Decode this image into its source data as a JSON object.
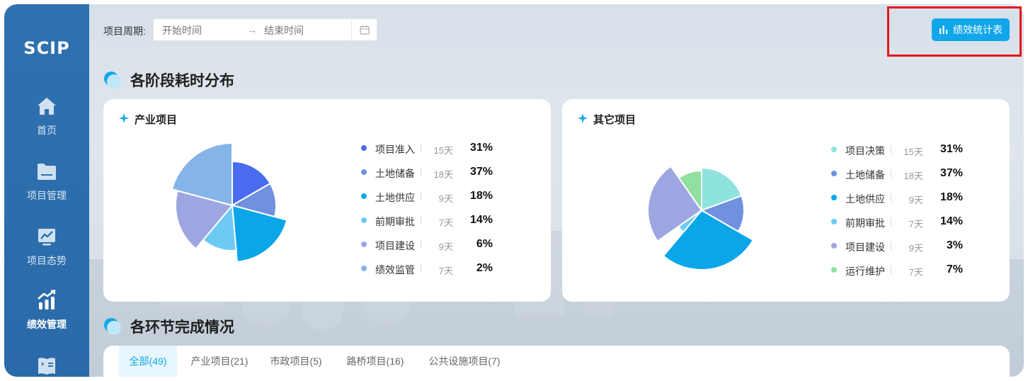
{
  "sidebar": {
    "logo": "SCIP",
    "items": [
      {
        "label": "首页",
        "icon": "home-icon",
        "active": false
      },
      {
        "label": "项目管理",
        "icon": "folder-icon",
        "active": false
      },
      {
        "label": "项目态势",
        "icon": "trend-chart-icon",
        "active": false
      },
      {
        "label": "绩效管理",
        "icon": "bar-chart-icon",
        "active": true
      },
      {
        "label": "",
        "icon": "book-icon",
        "active": false
      }
    ]
  },
  "toolbar": {
    "period_label": "项目周期:",
    "start_placeholder": "开始时间",
    "end_placeholder": "结束时间",
    "range_separator": "→",
    "stat_button_label": "绩效统计表"
  },
  "section1": {
    "title": "各阶段耗时分布"
  },
  "section2": {
    "title": "各环节完成情况"
  },
  "cards": [
    {
      "title": "产业项目",
      "items": [
        {
          "name": "项目准入",
          "days": "15天",
          "pct": "31%",
          "color": "#4a6cf0"
        },
        {
          "name": "土地储备",
          "days": "18天",
          "pct": "37%",
          "color": "#7090e0"
        },
        {
          "name": "土地供应",
          "days": "9天",
          "pct": "18%",
          "color": "#0aa6e8"
        },
        {
          "name": "前期审批",
          "days": "7天",
          "pct": "14%",
          "color": "#6ccaf5"
        },
        {
          "name": "项目建设",
          "days": "9天",
          "pct": "6%",
          "color": "#9ea6e2"
        },
        {
          "name": "绩效监管",
          "days": "7天",
          "pct": "2%",
          "color": "#85b4e8"
        }
      ]
    },
    {
      "title": "其它项目",
      "items": [
        {
          "name": "项目决策",
          "days": "15天",
          "pct": "31%",
          "color": "#8fe3de"
        },
        {
          "name": "土地储备",
          "days": "18天",
          "pct": "37%",
          "color": "#7090e0"
        },
        {
          "name": "土地供应",
          "days": "9天",
          "pct": "18%",
          "color": "#0aa6e8"
        },
        {
          "name": "前期审批",
          "days": "7天",
          "pct": "14%",
          "color": "#6ccaf5"
        },
        {
          "name": "项目建设",
          "days": "9天",
          "pct": "3%",
          "color": "#9ea6e2"
        },
        {
          "name": "运行维护",
          "days": "7天",
          "pct": "7%",
          "color": "#90e0a0"
        }
      ]
    }
  ],
  "tabs": [
    {
      "label": "全部(49)",
      "active": true
    },
    {
      "label": "产业项目(21)",
      "active": false
    },
    {
      "label": "市政项目(5)",
      "active": false
    },
    {
      "label": "路桥项目(16)",
      "active": false
    },
    {
      "label": "公共设施项目(7)",
      "active": false
    }
  ],
  "colors": {
    "sidebar_bg": "#2f72b1",
    "accent": "#11a6ea",
    "highlight": "#e6141a"
  }
}
